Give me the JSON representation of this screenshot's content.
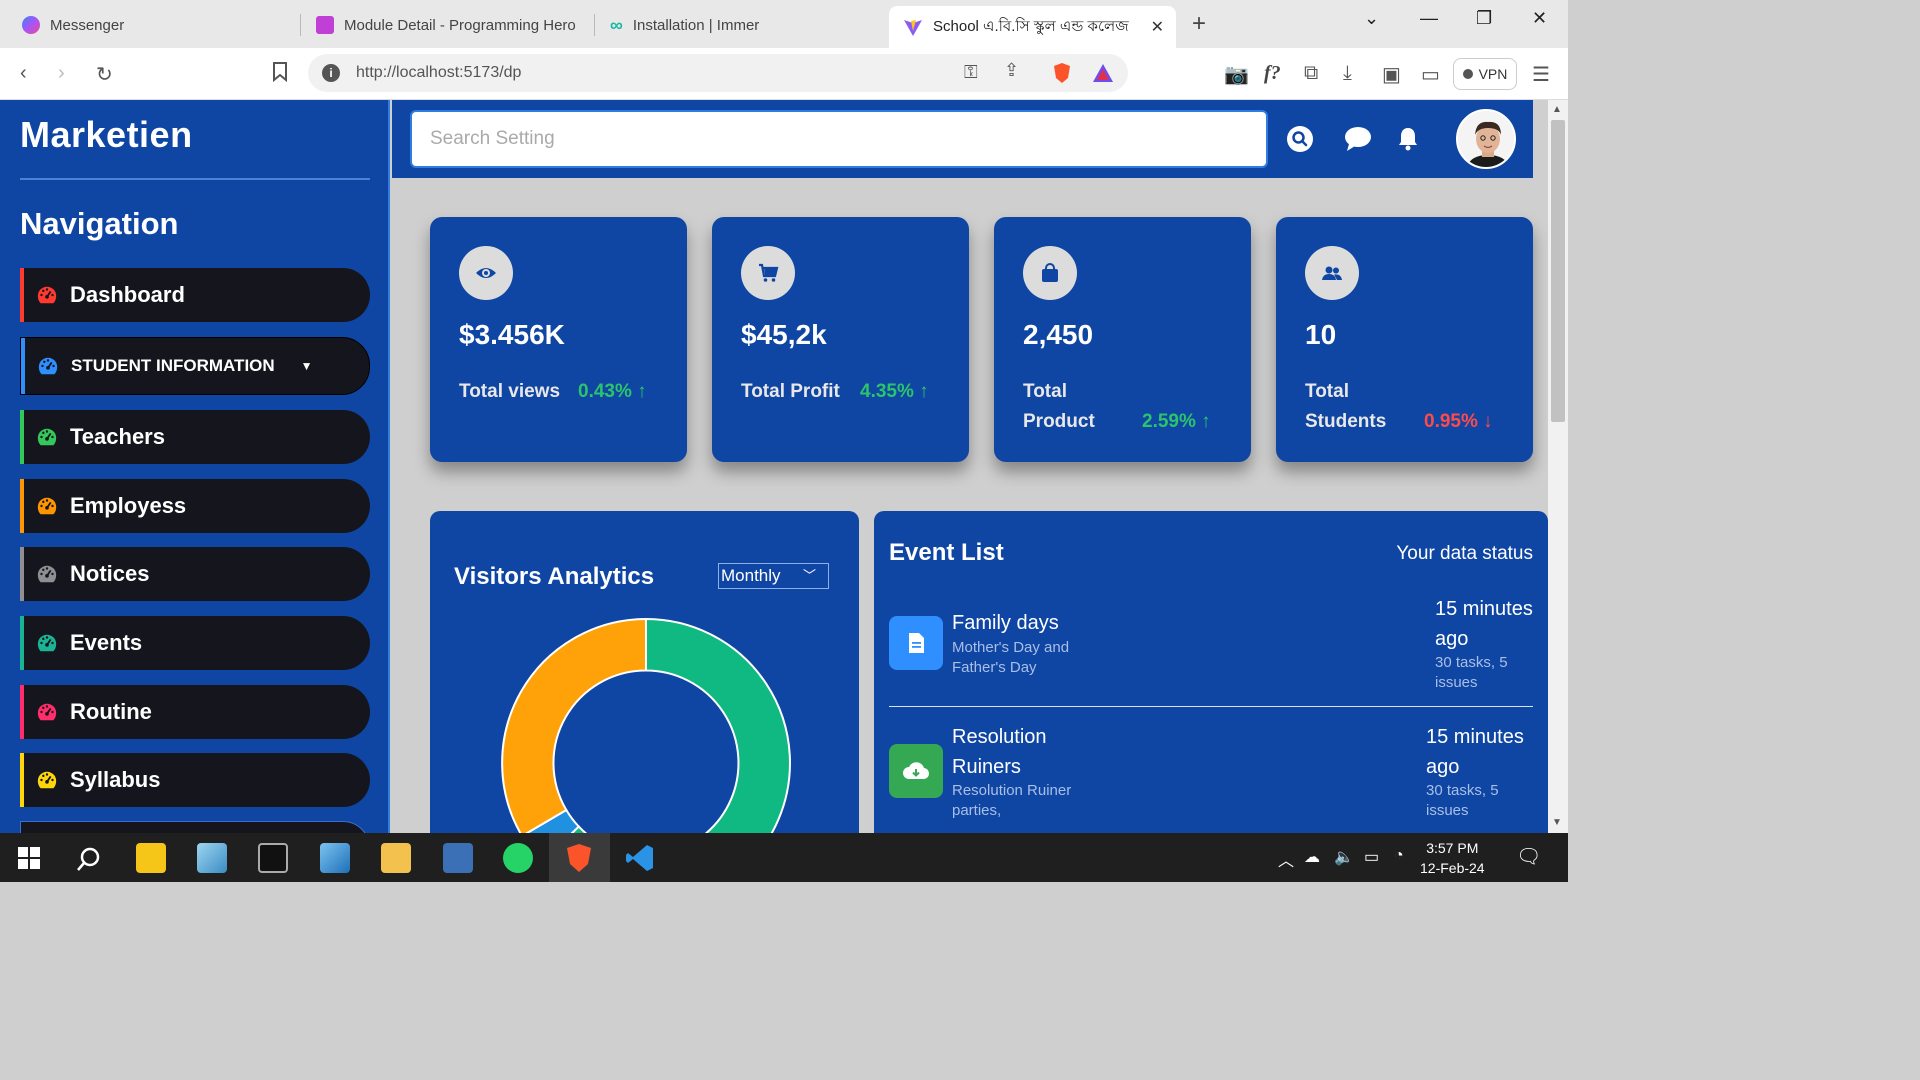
{
  "browser": {
    "tabs": [
      {
        "title": "Messenger",
        "icon": "messenger-icon",
        "color": "#8a3ffc"
      },
      {
        "title": "Module Detail - Programming Hero",
        "icon": "programming-hero-icon",
        "color": "#c03fd6"
      },
      {
        "title": "Installation | Immer",
        "icon": "immer-icon",
        "color": "#16b8a6"
      },
      {
        "title": "School এ.বি.সি স্কুল এন্ড কলেজ",
        "icon": "vite-icon",
        "color": "#8a5cf6"
      }
    ],
    "url": "http://localhost:5173/dp",
    "vpn_label": "VPN"
  },
  "sidebar": {
    "logo": "Marketien",
    "nav_title": "Navigation",
    "items": [
      {
        "label": "Dashboard",
        "color": "#ff3b30"
      },
      {
        "label": "STUDENT INFORMATION",
        "color": "#2f8fff"
      },
      {
        "label": "Teachers",
        "color": "#34c759"
      },
      {
        "label": "Employess",
        "color": "#ff9500"
      },
      {
        "label": "Notices",
        "color": "#8e8e93"
      },
      {
        "label": "Events",
        "color": "#1ab394"
      },
      {
        "label": "Routine",
        "color": "#ff2d6a"
      },
      {
        "label": "Syllabus",
        "color": "#ffd60a"
      }
    ]
  },
  "header": {
    "search_placeholder": "Search Setting"
  },
  "stats": [
    {
      "value": "$3.456K",
      "label_line1": "Total views",
      "label_line2": "",
      "change": "0.43%",
      "trend": "up",
      "icon": "eye-icon"
    },
    {
      "value": "$45,2k",
      "label_line1": "Total Profit",
      "label_line2": "",
      "change": "4.35%",
      "trend": "up",
      "icon": "cart-icon"
    },
    {
      "value": "2,450",
      "label_line1": "Total",
      "label_line2": "Product",
      "change": "2.59%",
      "trend": "up",
      "icon": "bag-icon"
    },
    {
      "value": "10",
      "label_line1": "Total",
      "label_line2": "Students",
      "change": "0.95%",
      "trend": "down",
      "icon": "users-icon"
    }
  ],
  "visitors": {
    "title": "Visitors Analytics",
    "period": "Monthly",
    "donut_colors": {
      "green": "#10b981",
      "orange": "#ffa20a",
      "blue": "#2090e0"
    }
  },
  "events": {
    "title": "Event List",
    "status": "Your data status",
    "items": [
      {
        "name_line1": "Family days",
        "name_line2": "",
        "desc_line1": "Mother's Day and",
        "desc_line2": "Father's Day",
        "time_line1": "15 minutes",
        "time_line2": "ago",
        "tasks_line1": "30 tasks, 5",
        "tasks_line2": "issues",
        "icon": "document-icon",
        "color": "#2f8fff"
      },
      {
        "name_line1": "Resolution",
        "name_line2": "Ruiners",
        "desc_line1": "Resolution Ruiner",
        "desc_line2": "parties,",
        "time_line1": "15 minutes",
        "time_line2": "ago",
        "tasks_line1": "30 tasks, 5",
        "tasks_line2": "issues",
        "icon": "cloud-download-icon",
        "color": "#34a853"
      }
    ]
  },
  "taskbar": {
    "time": "3:57 PM",
    "date": "12-Feb-24"
  }
}
